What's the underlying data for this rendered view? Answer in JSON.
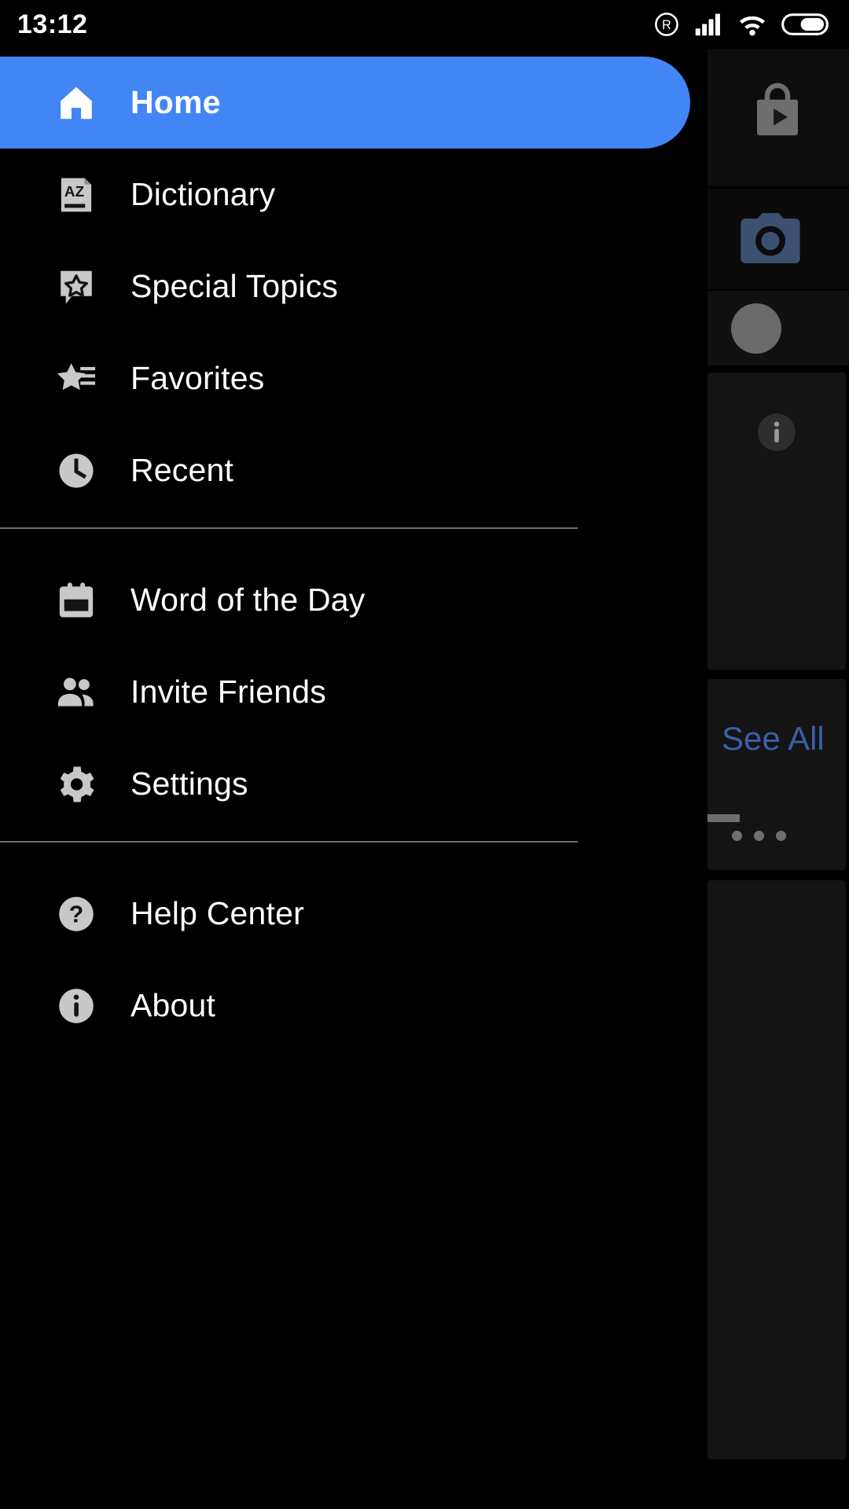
{
  "status_bar": {
    "time": "13:12",
    "icons": [
      {
        "name": "registered-trademark-icon",
        "glyph": "R"
      },
      {
        "name": "cellular-signal-icon",
        "bars": 4
      },
      {
        "name": "wifi-icon",
        "level": 3
      },
      {
        "name": "battery-icon",
        "level": 62
      }
    ]
  },
  "drawer": {
    "groups": [
      {
        "items": [
          {
            "label": "Home",
            "icon": "home-icon",
            "active": true
          },
          {
            "label": "Dictionary",
            "icon": "dictionary-book-icon",
            "active": false
          },
          {
            "label": "Special Topics",
            "icon": "star-bubble-icon",
            "active": false
          },
          {
            "label": "Favorites",
            "icon": "star-list-icon",
            "active": false
          },
          {
            "label": "Recent",
            "icon": "clock-icon",
            "active": false
          }
        ]
      },
      {
        "items": [
          {
            "label": "Word of the Day",
            "icon": "calendar-icon",
            "active": false
          },
          {
            "label": "Invite Friends",
            "icon": "people-icon",
            "active": false
          },
          {
            "label": "Settings",
            "icon": "gear-icon",
            "active": false
          }
        ]
      },
      {
        "items": [
          {
            "label": "Help Center",
            "icon": "help-question-icon",
            "active": false
          },
          {
            "label": "About",
            "icon": "info-icon",
            "active": false
          }
        ]
      }
    ]
  },
  "background": {
    "see_all_label": "See All",
    "icons": [
      {
        "name": "play-store-bag-icon"
      },
      {
        "name": "camera-icon"
      },
      {
        "name": "avatar-circle"
      },
      {
        "name": "info-icon"
      },
      {
        "name": "overflow-dots-icon"
      }
    ]
  },
  "colors": {
    "accent_blue": "#4285f4",
    "link_blue": "#3b5fa8",
    "drawer_bg": "#000000",
    "icon_grey": "#c8c8c8",
    "divider": "#6f6f6f",
    "card_bg": "#141414"
  }
}
